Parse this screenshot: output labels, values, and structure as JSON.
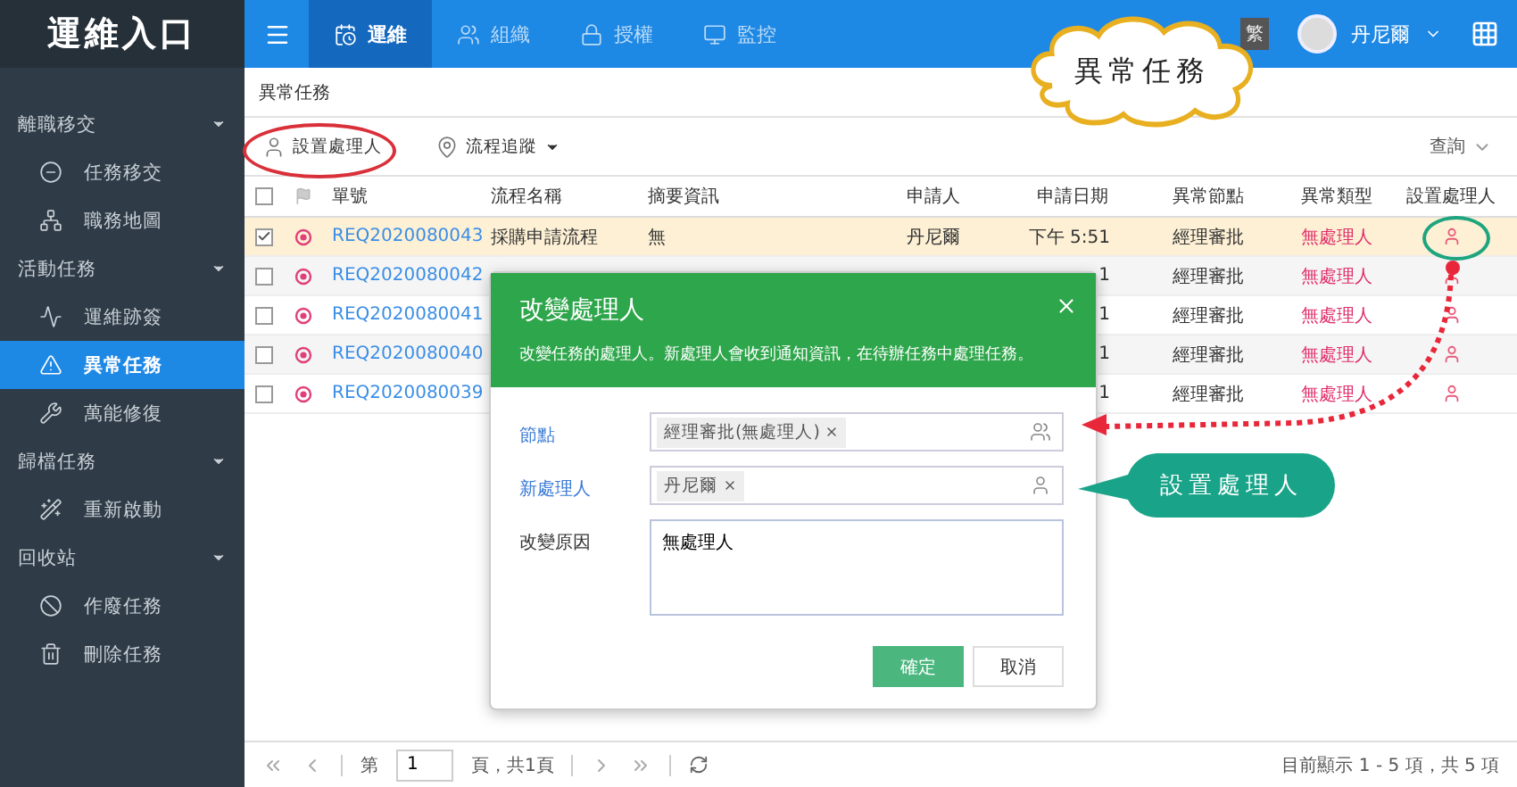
{
  "sidebar": {
    "title": "運維入口",
    "sections": [
      {
        "label": "離職移交",
        "expanded": true,
        "items": [
          {
            "label": "任務移交",
            "selected": false
          },
          {
            "label": "職務地圖",
            "selected": false
          }
        ]
      },
      {
        "label": "活動任務",
        "expanded": true,
        "items": [
          {
            "label": "運維跡簽",
            "selected": false
          },
          {
            "label": "異常任務",
            "selected": true
          },
          {
            "label": "萬能修復",
            "selected": false
          }
        ]
      },
      {
        "label": "歸檔任務",
        "expanded": true,
        "items": [
          {
            "label": "重新啟動",
            "selected": false
          }
        ]
      },
      {
        "label": "回收站",
        "expanded": true,
        "items": [
          {
            "label": "作廢任務",
            "selected": false
          },
          {
            "label": "刪除任務",
            "selected": false
          }
        ]
      }
    ]
  },
  "topnav": {
    "tabs": [
      {
        "label": "運維",
        "selected": true
      },
      {
        "label": "組織",
        "selected": false
      },
      {
        "label": "授權",
        "selected": false
      },
      {
        "label": "監控",
        "selected": false
      }
    ],
    "language": "繁",
    "user": "丹尼爾"
  },
  "breadcrumb": "異常任務",
  "toolbar": {
    "actions": [
      {
        "label": "設置處理人",
        "dropdown": false
      },
      {
        "label": "流程追蹤",
        "dropdown": true
      }
    ],
    "search": "查詢"
  },
  "table": {
    "select_all": false,
    "columns": [
      "單號",
      "流程名稱",
      "摘要資訊",
      "申請人",
      "申請日期",
      "異常節點",
      "異常類型",
      "設置處理人"
    ],
    "rows": [
      {
        "checked": true,
        "id": "REQ2020080043",
        "process": "採購申請流程",
        "summary": "無",
        "applicant": "丹尼爾",
        "date": "下午 5:51",
        "node": "經理審批",
        "type": "無處理人"
      },
      {
        "checked": false,
        "id": "REQ2020080042",
        "date": "1",
        "node": "經理審批",
        "type": "無處理人"
      },
      {
        "checked": false,
        "id": "REQ2020080041",
        "date": "1",
        "node": "經理審批",
        "type": "無處理人"
      },
      {
        "checked": false,
        "id": "REQ2020080040",
        "date": "1",
        "node": "經理審批",
        "type": "無處理人"
      },
      {
        "checked": false,
        "id": "REQ2020080039",
        "date": "1",
        "node": "經理審批",
        "type": "無處理人"
      }
    ]
  },
  "pagination": {
    "page_prefix": "第",
    "page": "1",
    "page_suffix": "頁，共1頁",
    "summary": "目前顯示 1 - 5 項，共 5 項"
  },
  "dialog": {
    "title": "改變處理人",
    "description": "改變任務的處理人。新處理人會收到通知資訊，在待辦任務中處理任務。",
    "fields": [
      {
        "label": "節點",
        "kind": "tags",
        "required": true,
        "tags": [
          "經理審批(無處理人)"
        ]
      },
      {
        "label": "新處理人",
        "kind": "tags",
        "required": true,
        "tags": [
          "丹尼爾"
        ]
      },
      {
        "label": "改變原因",
        "kind": "textarea",
        "required": false,
        "value": "無處理人"
      }
    ],
    "buttons": [
      {
        "label": "確定",
        "primary": true
      },
      {
        "label": "取消",
        "primary": false
      }
    ]
  },
  "annotations": {
    "cloud": "異常任務",
    "callout": "設置處理人"
  }
}
